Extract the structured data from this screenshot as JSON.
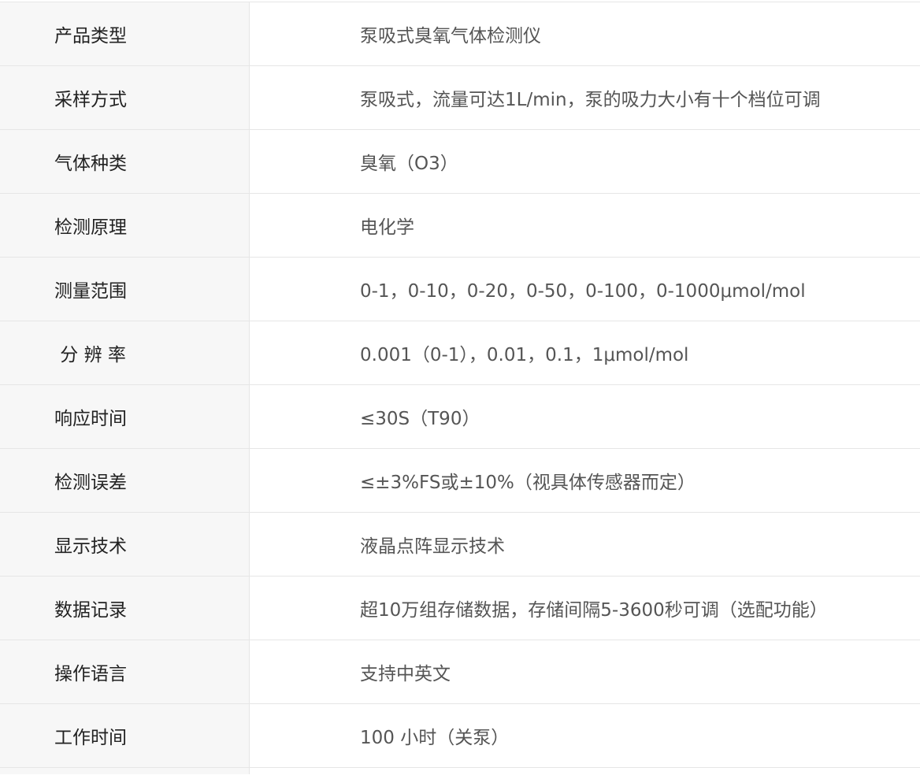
{
  "table": {
    "rows": [
      {
        "label": "产品类型",
        "value": "泵吸式臭氧气体检测仪"
      },
      {
        "label": "采样方式",
        "value": "泵吸式，流量可达1L/min，泵的吸力大小有十个档位可调"
      },
      {
        "label": "气体种类",
        "value": "臭氧（O3）"
      },
      {
        "label": "检测原理",
        "value": "电化学"
      },
      {
        "label": "测量范围",
        "value": "0-1，0-10，0-20，0-50，0-100，0-1000μmol/mol"
      },
      {
        "label": " 分 辨 率",
        "value": "0.001（0-1），0.01，0.1，1μmol/mol"
      },
      {
        "label": "响应时间",
        "value": "≤30S（T90）"
      },
      {
        "label": "检测误差",
        "value": "≤±3%FS或±10%（视具体传感器而定）"
      },
      {
        "label": "显示技术",
        "value": "液晶点阵显示技术"
      },
      {
        "label": "数据记录",
        "value": "超10万组存储数据，存储间隔5-3600秒可调（选配功能）"
      },
      {
        "label": "操作语言",
        "value": "支持中英文"
      },
      {
        "label": "工作时间",
        "value": "100 小时（关泵）"
      }
    ]
  }
}
